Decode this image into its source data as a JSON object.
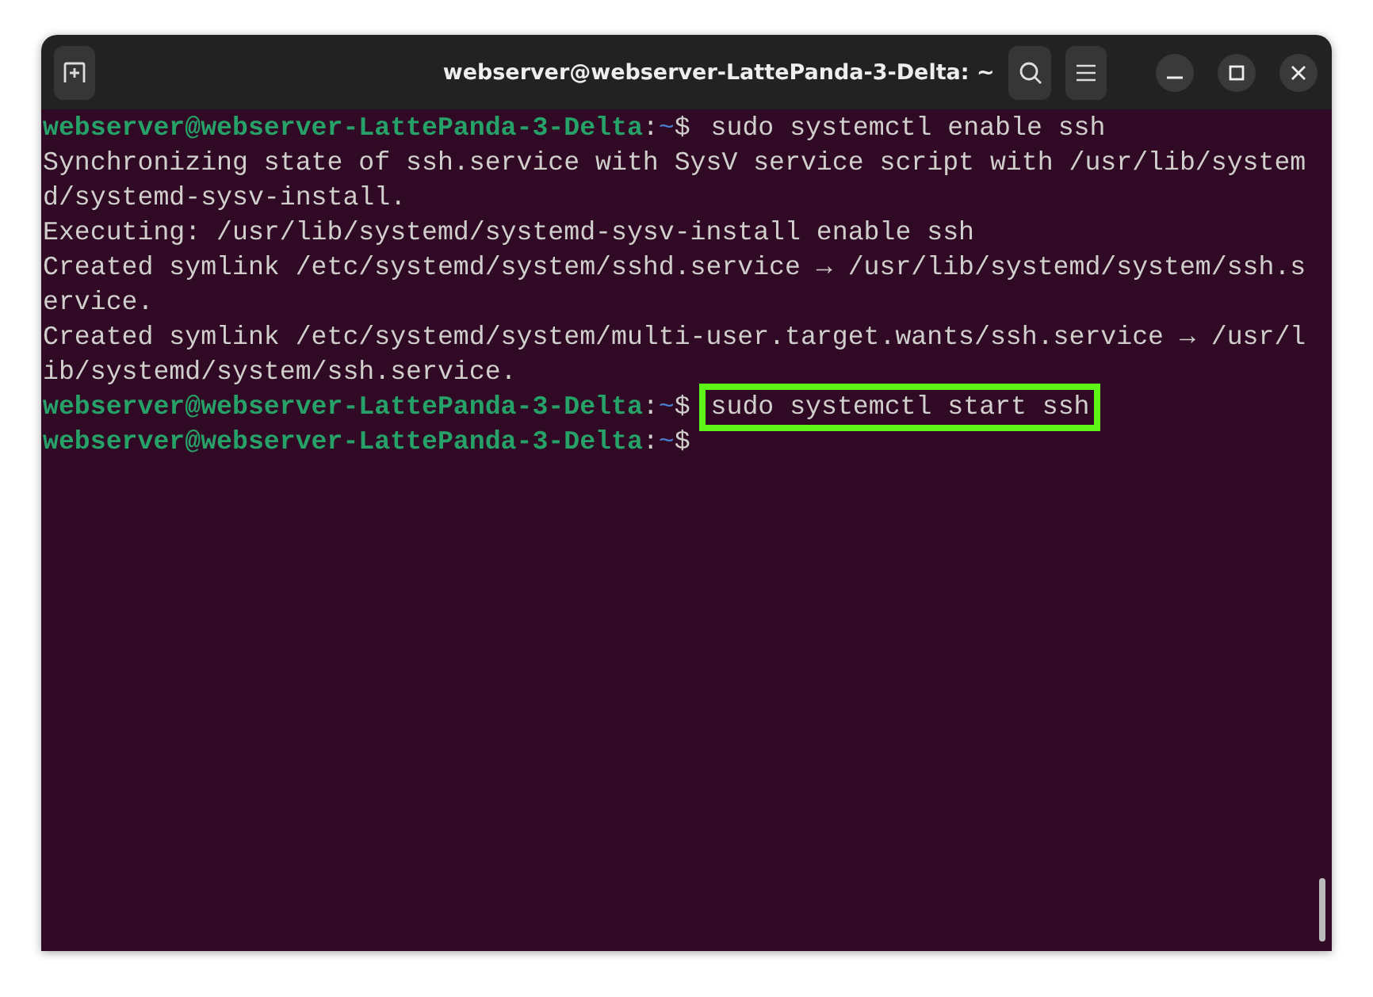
{
  "window": {
    "title": "webserver@webserver-LattePanda-3-Delta: ~"
  },
  "terminal": {
    "lines": [
      {
        "kind": "prompt",
        "user_host": "webserver@webserver-LattePanda-3-Delta",
        "separator": ":",
        "path": "~",
        "symbol": "$",
        "command": "sudo systemctl enable ssh",
        "highlighted": false
      },
      {
        "kind": "output",
        "text": "Synchronizing state of ssh.service with SysV service script with /usr/lib/system"
      },
      {
        "kind": "output",
        "text": "d/systemd-sysv-install."
      },
      {
        "kind": "output",
        "text": "Executing: /usr/lib/systemd/systemd-sysv-install enable ssh"
      },
      {
        "kind": "output",
        "text": "Created symlink /etc/systemd/system/sshd.service → /usr/lib/systemd/system/ssh.s"
      },
      {
        "kind": "output",
        "text": "ervice."
      },
      {
        "kind": "output",
        "text": "Created symlink /etc/systemd/system/multi-user.target.wants/ssh.service → /usr/l"
      },
      {
        "kind": "output",
        "text": "ib/systemd/system/ssh.service."
      },
      {
        "kind": "prompt",
        "user_host": "webserver@webserver-LattePanda-3-Delta",
        "separator": ":",
        "path": "~",
        "symbol": "$",
        "command": "sudo systemctl start ssh",
        "highlighted": true
      },
      {
        "kind": "prompt",
        "user_host": "webserver@webserver-LattePanda-3-Delta",
        "separator": ":",
        "path": "~",
        "symbol": "$"
      }
    ]
  }
}
